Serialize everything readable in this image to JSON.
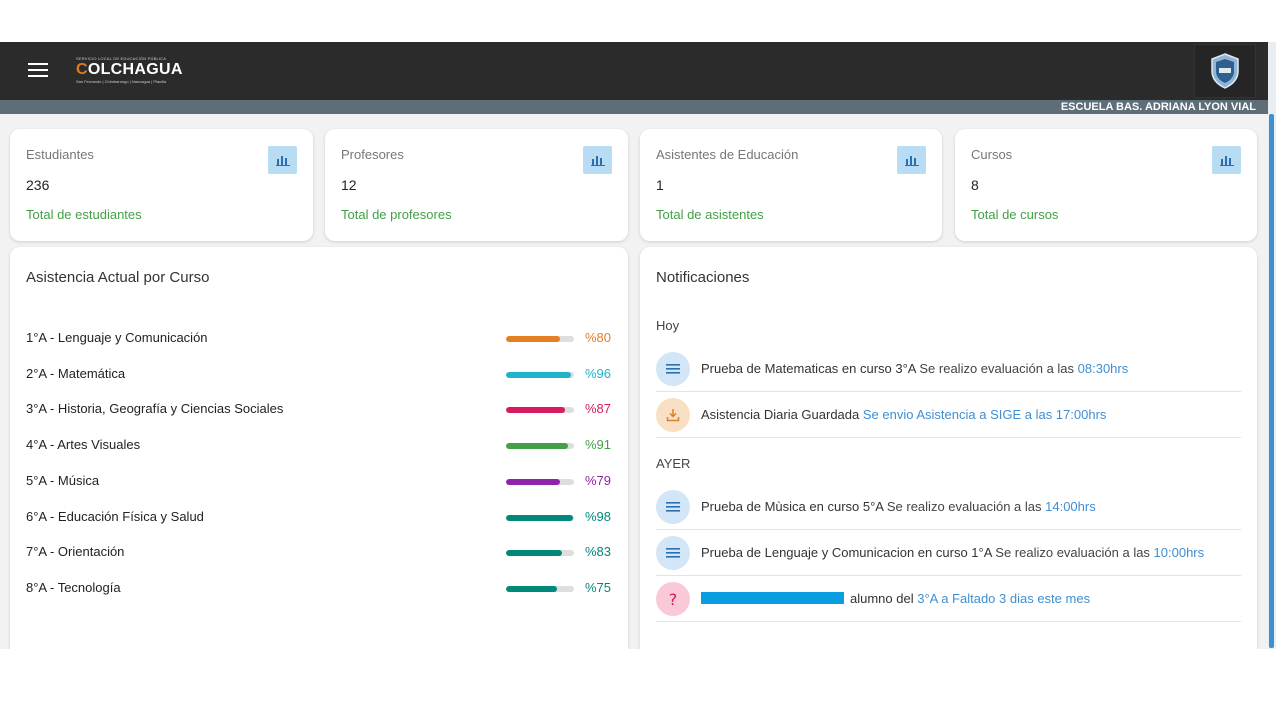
{
  "header": {
    "logo_top": "SERVICIO LOCAL DE EDUCACIÓN PÚBLICA",
    "logo_main": "COLCHAGUA",
    "logo_sub": "San Fernando | Chimbarongo | Nancagua | Placilla",
    "school_name": "ESCUELA BAS. ADRIANA LYON VIAL"
  },
  "stats": [
    {
      "label": "Estudiantes",
      "value": "236",
      "total": "Total de estudiantes",
      "icon": "bar-chart-icon"
    },
    {
      "label": "Profesores",
      "value": "12",
      "total": "Total de profesores",
      "icon": "bar-chart-icon"
    },
    {
      "label": "Asistentes de Educación",
      "value": "1",
      "total": "Total de asistentes",
      "icon": "bar-chart-icon"
    },
    {
      "label": "Cursos",
      "value": "8",
      "total": "Total de cursos",
      "icon": "bar-chart-icon"
    }
  ],
  "attendance": {
    "title": "Asistencia Actual por Curso",
    "courses": [
      {
        "name": "1°A - Lenguaje y Comunicación",
        "pct_label": "%80",
        "value": 80,
        "color": "#e67e22"
      },
      {
        "name": "2°A - Matemática",
        "pct_label": "%96",
        "value": 96,
        "color": "#1cb5cc"
      },
      {
        "name": "3°A - Historia, Geografía y Ciencias Sociales",
        "pct_label": "%87",
        "value": 87,
        "color": "#d81b60"
      },
      {
        "name": "4°A - Artes Visuales",
        "pct_label": "%91",
        "value": 91,
        "color": "#43a047"
      },
      {
        "name": "5°A - Música",
        "pct_label": "%79",
        "value": 79,
        "color": "#8e24aa"
      },
      {
        "name": "6°A - Educación Física y Salud",
        "pct_label": "%98",
        "value": 98,
        "color": "#00897b"
      },
      {
        "name": "7°A - Orientación",
        "pct_label": "%83",
        "value": 83,
        "color": "#00897b"
      },
      {
        "name": "8°A - Tecnología",
        "pct_label": "%75",
        "value": 75,
        "color": "#00897b"
      }
    ]
  },
  "notifications": {
    "title": "Notificaciones",
    "today_label": "Hoy",
    "yesterday_label": "AYER",
    "today": [
      {
        "icon": "list-icon",
        "icon_bg": "#d3e6f7",
        "main": "Prueba de Matematicas en curso 3°A",
        "detail": " Se realizo evaluación a las ",
        "link": "08:30hrs"
      },
      {
        "icon": "download-icon",
        "icon_bg": "#f9dfc4",
        "main": "Asistencia Diaria Guardada",
        "detail": " ",
        "link": "Se envio Asistencia a SIGE a las 17:00hrs"
      }
    ],
    "yesterday": [
      {
        "icon": "list-icon",
        "icon_bg": "#d3e6f7",
        "main": "Prueba de Mùsica en curso 5°A",
        "detail": " Se realizo evaluación a las ",
        "link": "14:00hrs"
      },
      {
        "icon": "list-icon",
        "icon_bg": "#d3e6f7",
        "main": "Prueba de Lenguaje y Comunicacion en curso 1°A",
        "detail": " Se realizo evaluación a las ",
        "link": "10:00hrs"
      },
      {
        "icon": "help-icon",
        "icon_bg": "#f9c9d8",
        "main": "alumno del ",
        "detail": "",
        "link": "3°A a Faltado 3 dias este mes"
      }
    ]
  }
}
